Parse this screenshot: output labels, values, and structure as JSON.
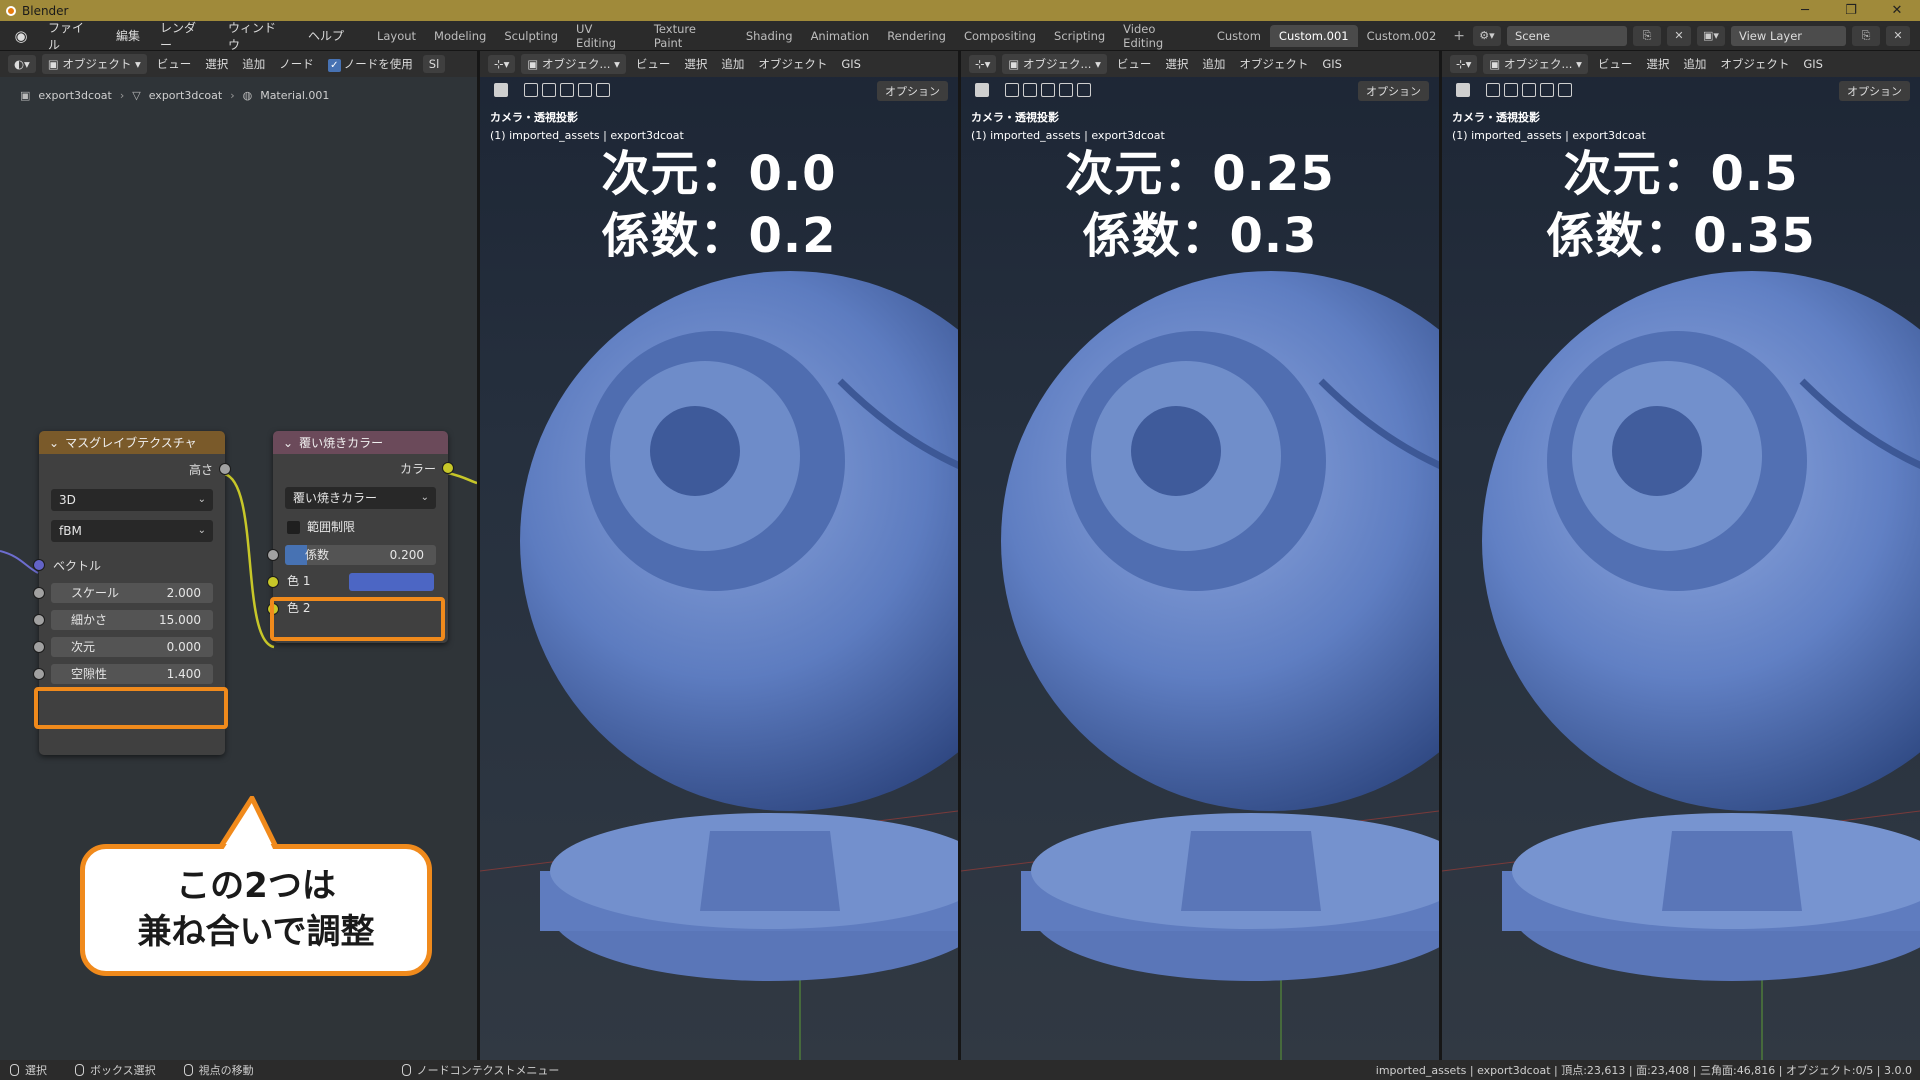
{
  "titlebar": {
    "title": "Blender",
    "min": "─",
    "max": "❐",
    "close": "✕"
  },
  "menu": {
    "items": [
      "ファイル",
      "編集",
      "レンダー",
      "ウィンドウ",
      "ヘルプ"
    ],
    "workspaces": [
      "Layout",
      "Modeling",
      "Sculpting",
      "UV Editing",
      "Texture Paint",
      "Shading",
      "Animation",
      "Rendering",
      "Compositing",
      "Scripting",
      "Video Editing",
      "Custom",
      "Custom.001",
      "Custom.002"
    ],
    "active_workspace": "Custom.001",
    "add_tab": "+",
    "scene": "Scene",
    "view_layer": "View Layer"
  },
  "node_editor": {
    "header": {
      "mode": "オブジェクト",
      "menus": [
        "ビュー",
        "選択",
        "追加",
        "ノード"
      ],
      "use_nodes_label": "ノードを使用",
      "slot": "Sl"
    },
    "breadcrumb": [
      "export3dcoat",
      "export3dcoat",
      "Material.001"
    ],
    "musgrave": {
      "title": "マスグレイブテクスチャ",
      "output": "高さ",
      "dim_select": "3D",
      "type_select": "fBM",
      "vector": "ベクトル",
      "fields": [
        {
          "label": "スケール",
          "value": "2.000"
        },
        {
          "label": "細かさ",
          "value": "15.000"
        },
        {
          "label": "次元",
          "value": "0.000"
        },
        {
          "label": "空隙性",
          "value": "1.400"
        }
      ]
    },
    "mix": {
      "title": "覆い焼きカラー",
      "output": "カラー",
      "blend_select": "覆い焼きカラー",
      "clamp": "範囲制限",
      "factor_label": "係数",
      "factor_value": "0.200",
      "color1": "色 1",
      "color2": "色 2",
      "color1_hex": "#4c66c4"
    },
    "callout_lines": [
      "この2つは",
      "兼ね合いで調整"
    ]
  },
  "viewports": [
    {
      "mode": "オブジェク...",
      "menus": [
        "ビュー",
        "選択",
        "追加",
        "オブジェクト",
        "GIS"
      ],
      "options": "オプション",
      "camera": "カメラ・透視投影",
      "collection": "(1) imported_assets | export3dcoat",
      "line1": "次元：0.0",
      "line2": "係数：0.2"
    },
    {
      "mode": "オブジェク...",
      "menus": [
        "ビュー",
        "選択",
        "追加",
        "オブジェクト",
        "GIS"
      ],
      "options": "オプション",
      "camera": "カメラ・透視投影",
      "collection": "(1) imported_assets | export3dcoat",
      "line1": "次元：0.25",
      "line2": "係数：0.3"
    },
    {
      "mode": "オブジェク...",
      "menus": [
        "ビュー",
        "選択",
        "追加",
        "オブジェクト",
        "GIS"
      ],
      "options": "オプション",
      "camera": "カメラ・透視投影",
      "collection": "(1) imported_assets | export3dcoat",
      "line1": "次元：0.5",
      "line2": "係数：0.35"
    }
  ],
  "statusbar": {
    "select": "選択",
    "box_select": "ボックス選択",
    "move_view": "視点の移動",
    "context_menu": "ノードコンテクストメニュー",
    "stats": "imported_assets | export3dcoat | 頂点:23,613 | 面:23,408 | 三角面:46,816 | オブジェクト:0/5 | 3.0.0"
  },
  "colors": {
    "highlight": "#f08a1c",
    "active_tab": "#4a4a4a",
    "sphere": "#5d7cc0"
  }
}
